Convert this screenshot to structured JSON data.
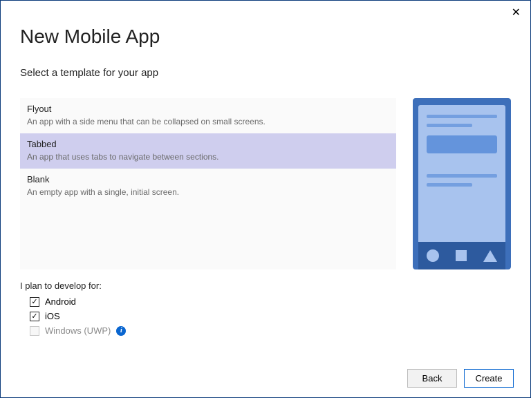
{
  "dialog": {
    "title": "New Mobile App",
    "subtitle": "Select a template for your app",
    "close_glyph": "✕"
  },
  "templates": [
    {
      "name": "Flyout",
      "desc": "An app with a side menu that can be collapsed on small screens.",
      "selected": false
    },
    {
      "name": "Tabbed",
      "desc": "An app that uses tabs to navigate between sections.",
      "selected": true
    },
    {
      "name": "Blank",
      "desc": "An empty app with a single, initial screen.",
      "selected": false
    }
  ],
  "platforms": {
    "label": "I plan to develop for:",
    "items": [
      {
        "label": "Android",
        "checked": true,
        "disabled": false,
        "info": false
      },
      {
        "label": "iOS",
        "checked": true,
        "disabled": false,
        "info": false
      },
      {
        "label": "Windows (UWP)",
        "checked": false,
        "disabled": true,
        "info": true
      }
    ]
  },
  "buttons": {
    "back": "Back",
    "create": "Create"
  },
  "checkmark_glyph": "✓",
  "info_glyph": "i"
}
